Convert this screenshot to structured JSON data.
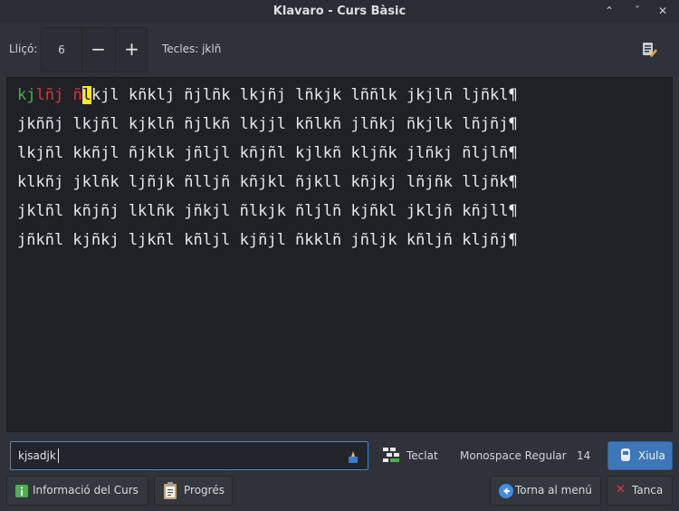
{
  "window": {
    "title": "Klavaro - Curs Bàsic",
    "controls": [
      "⌃",
      "ˇ",
      "✕"
    ]
  },
  "toolbar": {
    "lesson_label": "Lliçó:",
    "lesson_value": "6",
    "decrement_label": "−",
    "increment_label": "+",
    "keys_label": "Tecles: jklñ"
  },
  "exercise": {
    "line1": {
      "typed_correct": "kj",
      "typed_error": "lñj",
      "space1": " ",
      "typed_error2": "ñ",
      "cursor_char": "l",
      "rest": "kjl kñklj ñjlñk lkjñj lñkjk lññlk jkjlñ ljñkl¶"
    },
    "lines": [
      "jkññj lkjñl kjklñ ñjlkñ lkjjl kñlkñ jlñkj ñkjlk lñjñj¶",
      "lkjñl kkñjl ñjklk jñljl kñjñl kjlkñ kljñk jlñkj ñljlñ¶",
      "klkñj jklñk ljñjk ñlljñ kñjkl ñjkll kñjkj lñjñk lljñk¶",
      "jklñl kñjñj lklñk jñkjl ñlkjk ñljlñ kjñkl jkljñ kñjll¶",
      "jñkñl kjñkj ljkñl kñljl kjñjl ñkklñ jñljk kñljñ kljñj¶"
    ]
  },
  "input": {
    "value": "kjsadjk"
  },
  "controls": {
    "keyboard_label": "Teclat",
    "font_name": "Monospace Regular",
    "font_size": "14",
    "whistle_label": "Xiula"
  },
  "footer": {
    "course_info_label": "Informació del Curs",
    "progress_label": "Progrés",
    "back_menu_label": "Torna al menú",
    "close_label": "Tanca"
  },
  "colors": {
    "correct": "#4caf50",
    "error": "#e0303a",
    "cursor": "#f6e72a",
    "accent": "#3d76b9"
  }
}
